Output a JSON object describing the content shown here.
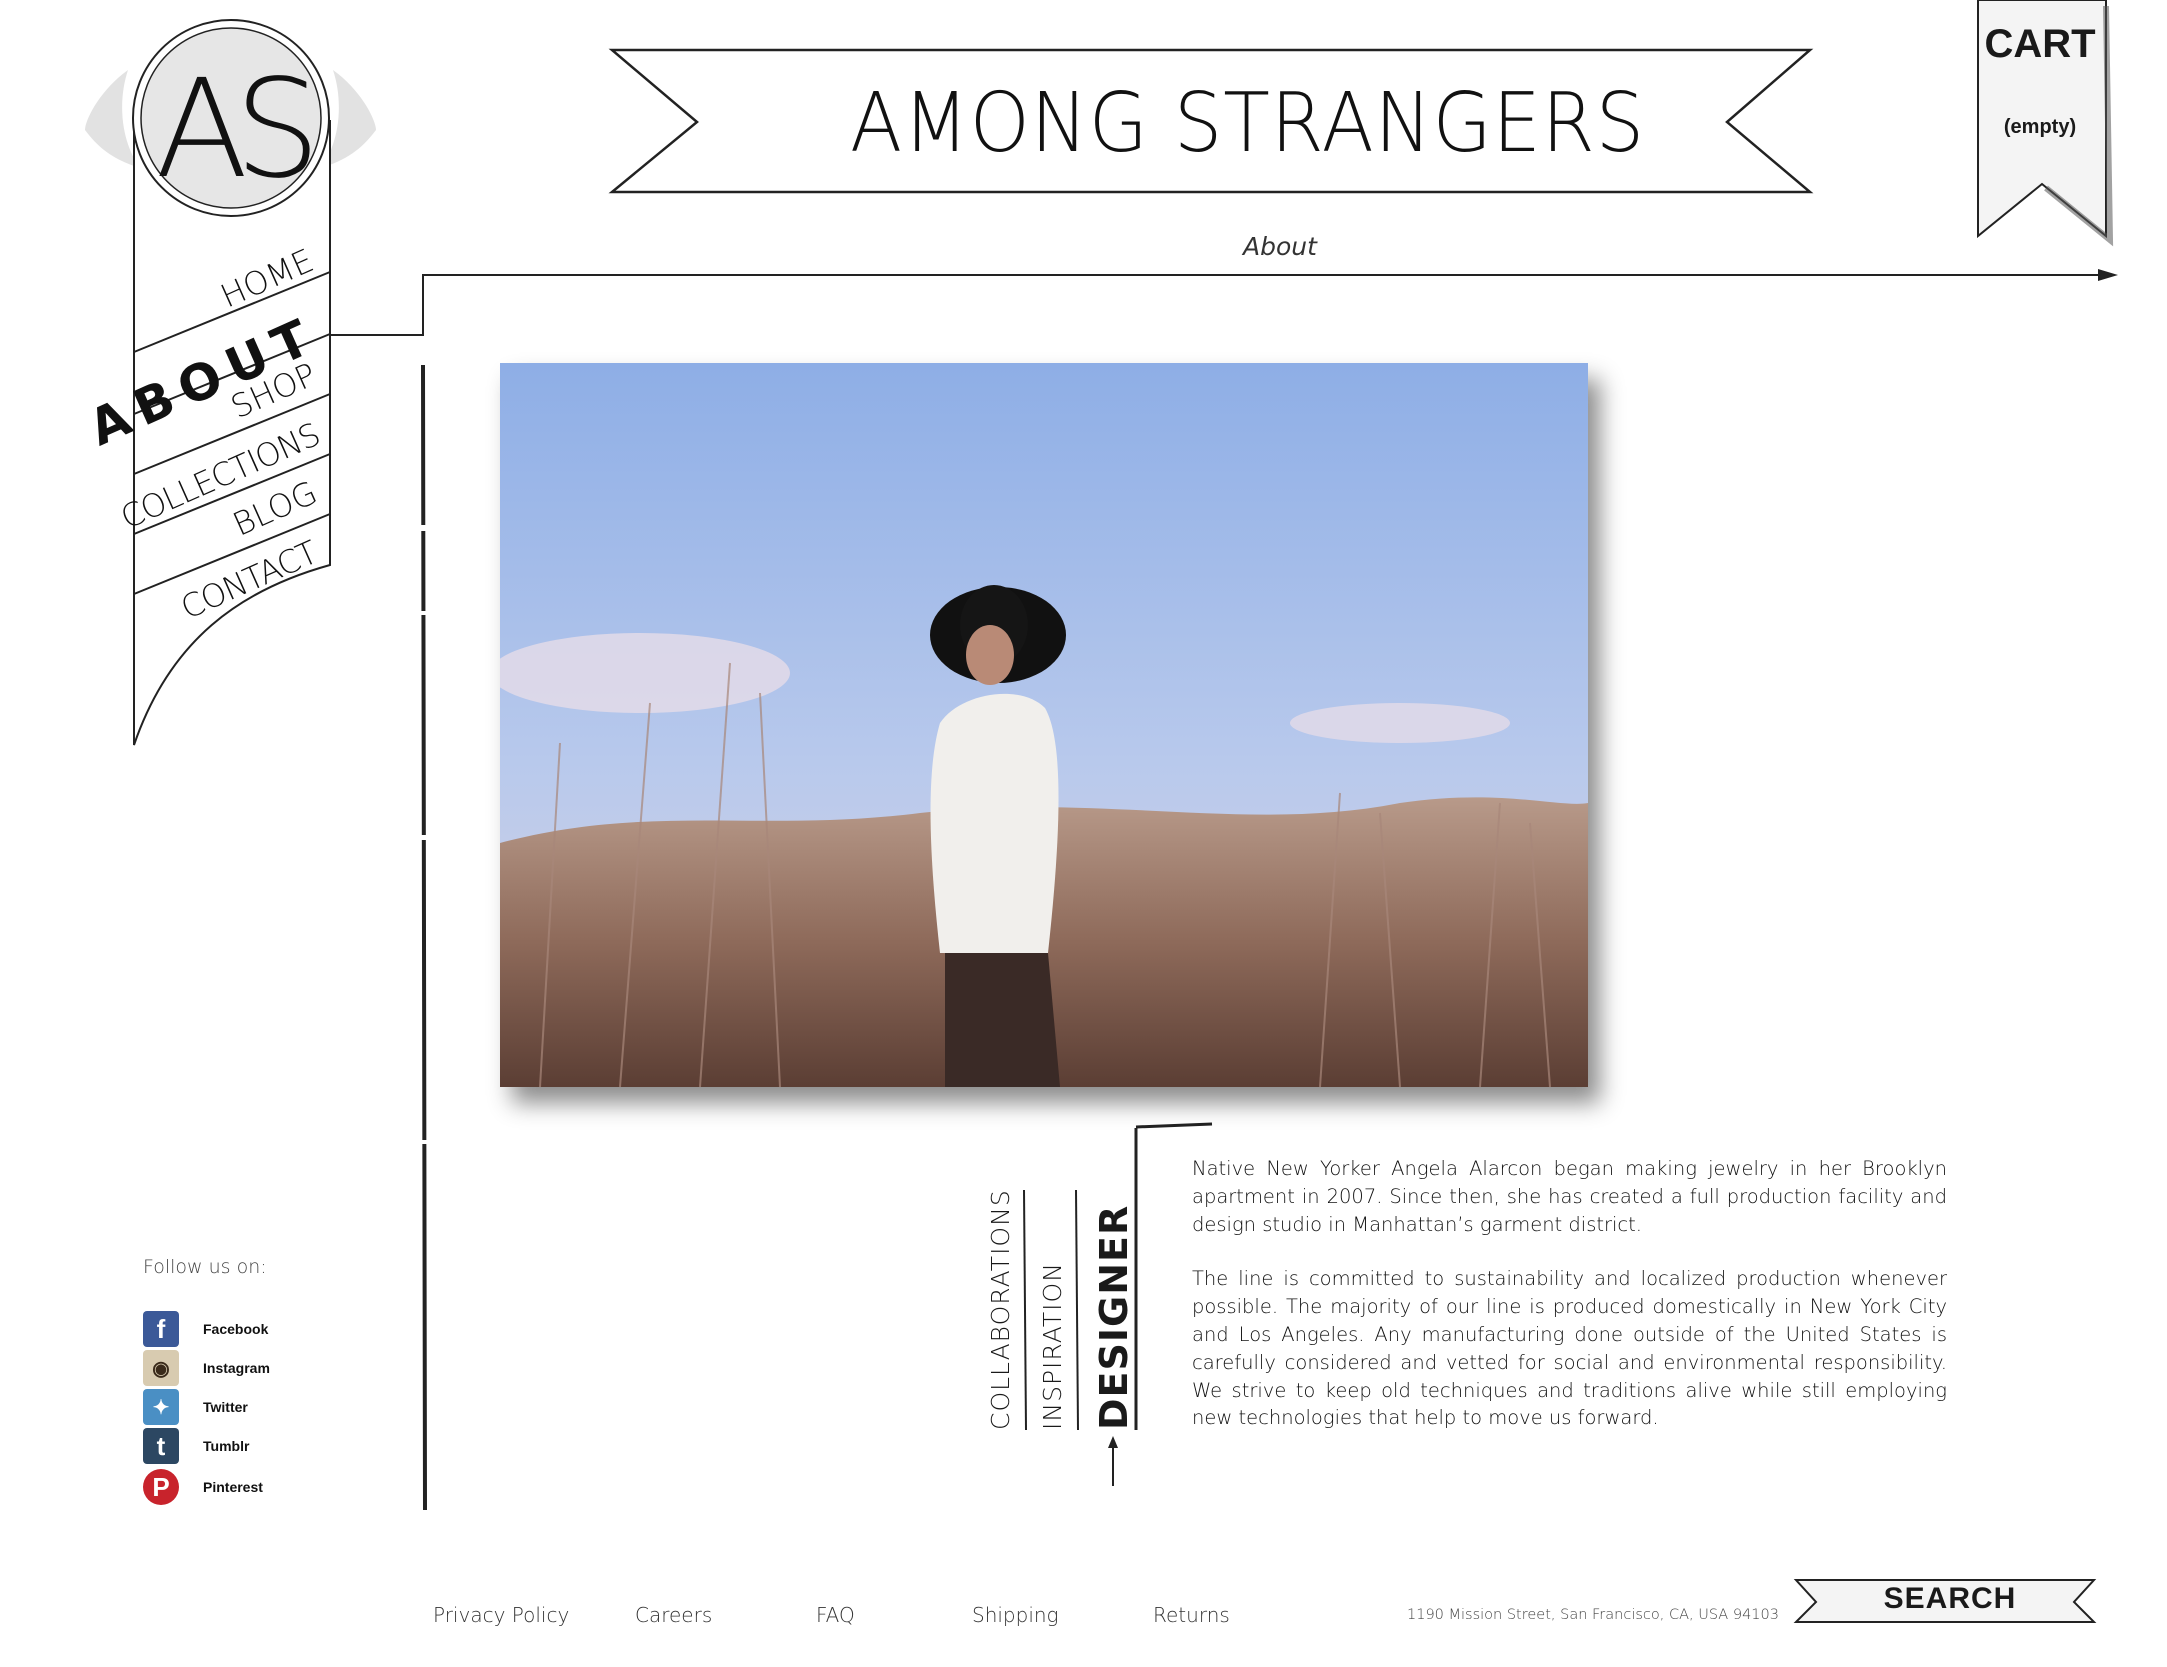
{
  "brand": {
    "logo_initials": "AS",
    "site_title": "AMONG STRANGERS"
  },
  "cart": {
    "label": "CART",
    "status": "(empty)"
  },
  "breadcrumb": {
    "current": "About"
  },
  "nav": {
    "items": [
      {
        "label": "HOME",
        "active": false
      },
      {
        "label": "ABOUT",
        "active": true
      },
      {
        "label": "SHOP",
        "active": false
      },
      {
        "label": "COLLECTIONS",
        "active": false
      },
      {
        "label": "BLOG",
        "active": false
      },
      {
        "label": "CONTACT",
        "active": false
      }
    ]
  },
  "about": {
    "tabs": [
      {
        "label": "COLLABORATIONS",
        "active": false
      },
      {
        "label": "INSPIRATION",
        "active": false
      },
      {
        "label": "DESIGNER",
        "active": true
      }
    ],
    "paragraphs": [
      "Native New Yorker Angela Alarcon began making jewelry in her Brooklyn apartment in 2007. Since then, she has created a full production facility and design studio in Manhattan’s garment district.",
      "The line is committed to sustainability and localized production whenever possible. The majority of our line is produced domestically in New York City and Los Angeles. Any manufacturing done outside of the United States is carefully considered and vetted for social and environmental responsibility. We strive to keep old techniques and traditions alive while still employing new technologies that help to move us forward."
    ]
  },
  "social": {
    "heading": "Follow us on:",
    "links": [
      {
        "label": "Facebook",
        "icon": "facebook-icon",
        "color": "#3b5998"
      },
      {
        "label": "Instagram",
        "icon": "instagram-icon",
        "color": "#8a6a4a"
      },
      {
        "label": "Twitter",
        "icon": "twitter-icon",
        "color": "#4a8fc4"
      },
      {
        "label": "Tumblr",
        "icon": "tumblr-icon",
        "color": "#2c4762"
      },
      {
        "label": "Pinterest",
        "icon": "pinterest-icon",
        "color": "#c8232c"
      }
    ]
  },
  "footer": {
    "links": [
      "Privacy Policy",
      "Careers",
      "FAQ",
      "Shipping",
      "Returns"
    ],
    "address": "1190 Mission Street, San Francisco, CA, USA 94103",
    "search_label": "SEARCH"
  }
}
